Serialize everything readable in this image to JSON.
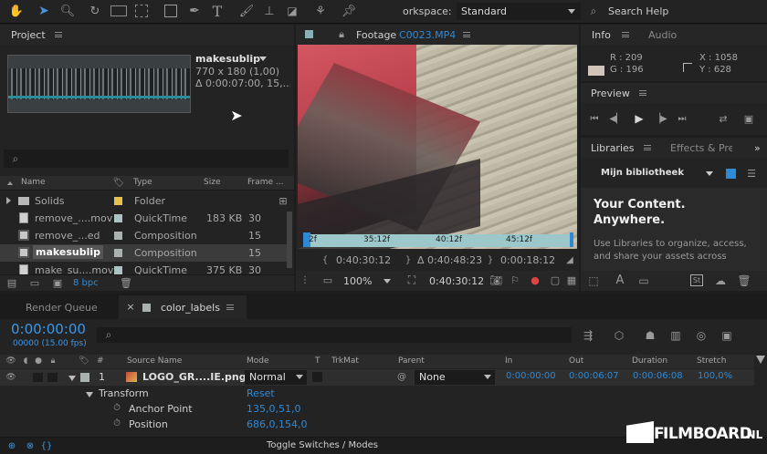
{
  "toolbar": {
    "workspace_label": "orkspace:",
    "workspace_value": "Standard",
    "search_placeholder": "Search Help"
  },
  "project": {
    "title": "Project",
    "item_name": "makesublip",
    "item_dims": "770 x 180 (1,00)",
    "item_duration": "Δ 0:00:07:00, 15,...",
    "columns": {
      "name": "Name",
      "type": "Type",
      "size": "Size",
      "frame": "Frame ..."
    },
    "rows": [
      {
        "name": "Solids",
        "type": "Folder",
        "size": "",
        "frame": "",
        "color": "#e6c14a"
      },
      {
        "name": "remove_....mov",
        "type": "QuickTime",
        "size": "183 KB",
        "frame": "30",
        "color": "#a9c4c2"
      },
      {
        "name": "remove_...ed",
        "type": "Composition",
        "size": "",
        "frame": "15",
        "color": "#a9b2ae"
      },
      {
        "name": "makesublip",
        "type": "Composition",
        "size": "",
        "frame": "15",
        "color": "#a9b2ae"
      },
      {
        "name": "make_su....mov",
        "type": "QuickTime",
        "size": "375 KB",
        "frame": "30",
        "color": "#a9c4c2"
      }
    ],
    "bpc": "8 bpc"
  },
  "footage": {
    "title_prefix": "Footage",
    "title_file": "C0023.MP4",
    "ruler_labels": [
      "2f",
      "35:12f",
      "40:12f",
      "45:12f"
    ],
    "time_start": "0:40:30:12",
    "time_duration": "Δ 0:40:48:23",
    "time_end": "0:00:18:12",
    "zoom": "100%",
    "current_time": "0:40:30:12"
  },
  "info": {
    "tab_info": "Info",
    "tab_audio": "Audio",
    "r": "R : 209",
    "g": "G : 196",
    "x": "X : 1058",
    "y": "Y : 628"
  },
  "preview": {
    "title": "Preview"
  },
  "libraries": {
    "tab": "Libraries",
    "tab2": "Effects & Pres",
    "selected_library": "Mijn bibliotheek",
    "headline_1": "Your Content.",
    "headline_2": "Anywhere.",
    "body_1": "Use Libraries to organize, access,",
    "body_2": "and share your assets across"
  },
  "timeline": {
    "tab_render": "Render Queue",
    "tab_comp": "color_labels",
    "timecode": "0:00:00:00",
    "timecode_sub": "00000 (15.00 fps)",
    "columns": {
      "num": "#",
      "source": "Source Name",
      "mode": "Mode",
      "t": "T",
      "trkmat": "TrkMat",
      "parent": "Parent",
      "in": "In",
      "out": "Out",
      "duration": "Duration",
      "stretch": "Stretch"
    },
    "layer": {
      "num": "1",
      "name": "LOGO_GR....IE.png",
      "mode": "Normal",
      "parent": "None",
      "in": "0:00:00:00",
      "out": "0:00:06:07",
      "duration": "0:00:06:08",
      "stretch": "100,0%"
    },
    "transform_label": "Transform",
    "reset_label": "Reset",
    "anchor_label": "Anchor Point",
    "anchor_value": "135,0,51,0",
    "position_label": "Position",
    "position_value": "686,0,154,0",
    "toggle_label": "Toggle Switches / Modes"
  },
  "watermark": {
    "text_1": "F",
    "text_2": "ILMBOARD",
    "text_3": ".NL"
  }
}
